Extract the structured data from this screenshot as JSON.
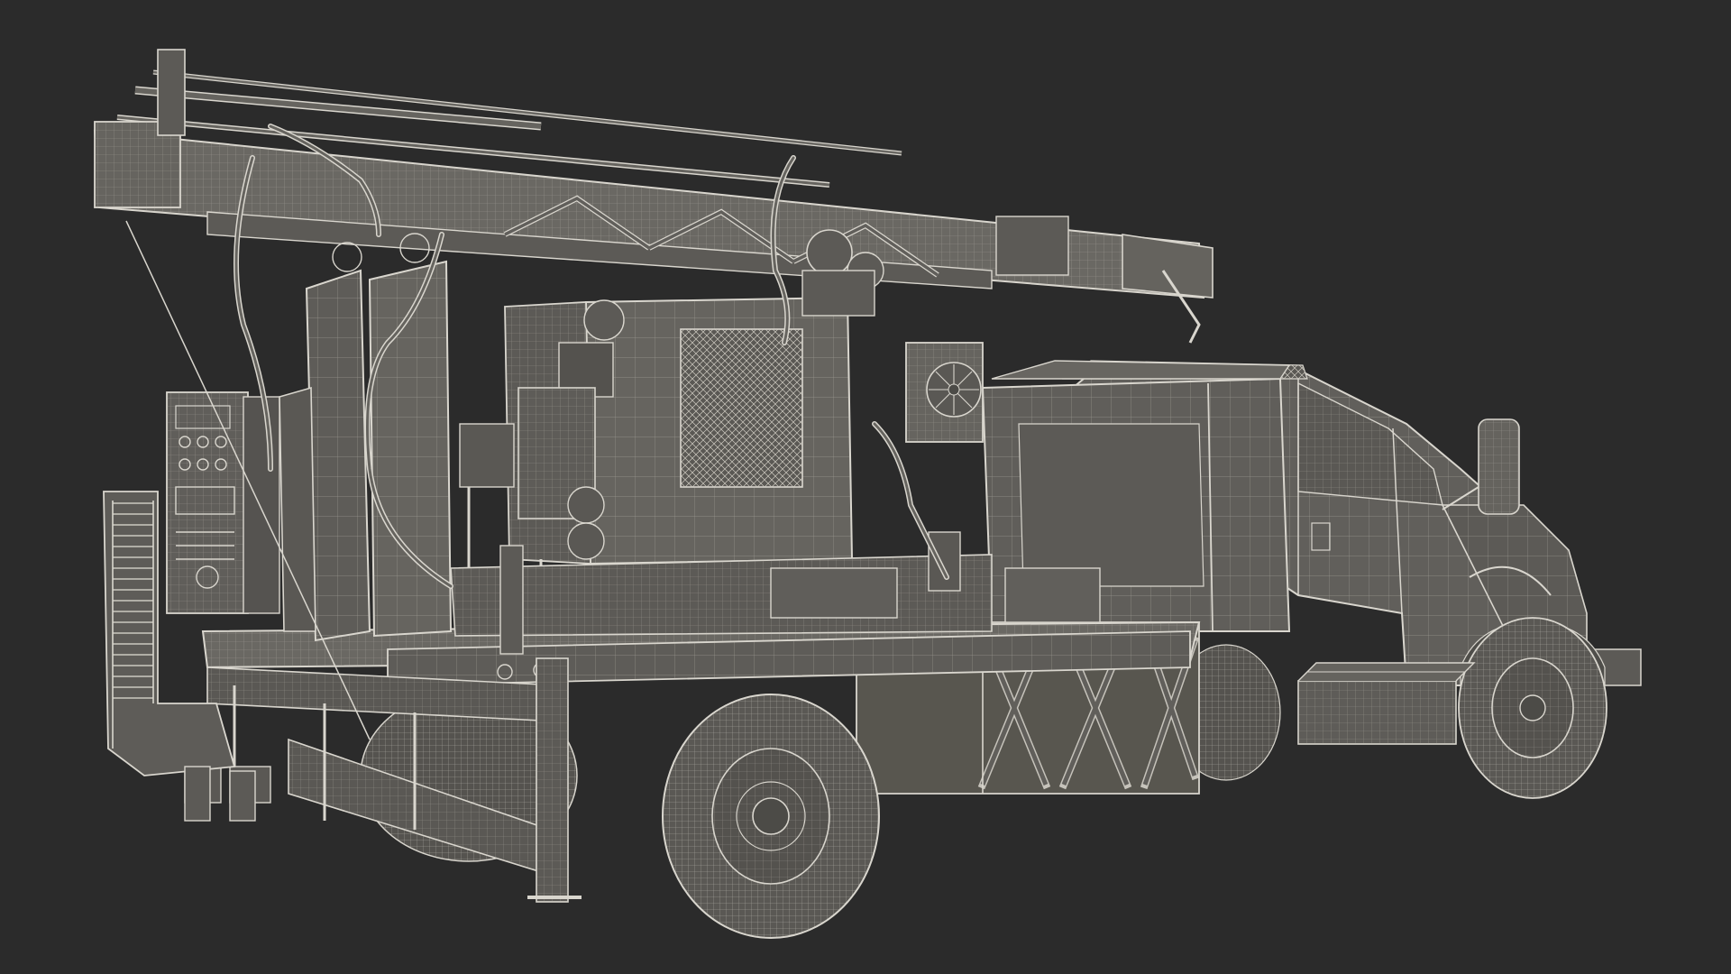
{
  "image": {
    "subject": "drill-rig-truck-wireframe",
    "colors": {
      "background": "#2b2b2b",
      "fill": "#615f5b",
      "fill_dark": "#4f4e4a",
      "fill_light": "#6d6b66",
      "wire": "#d9d6ce",
      "wire_dim": "#a9a69e"
    }
  }
}
